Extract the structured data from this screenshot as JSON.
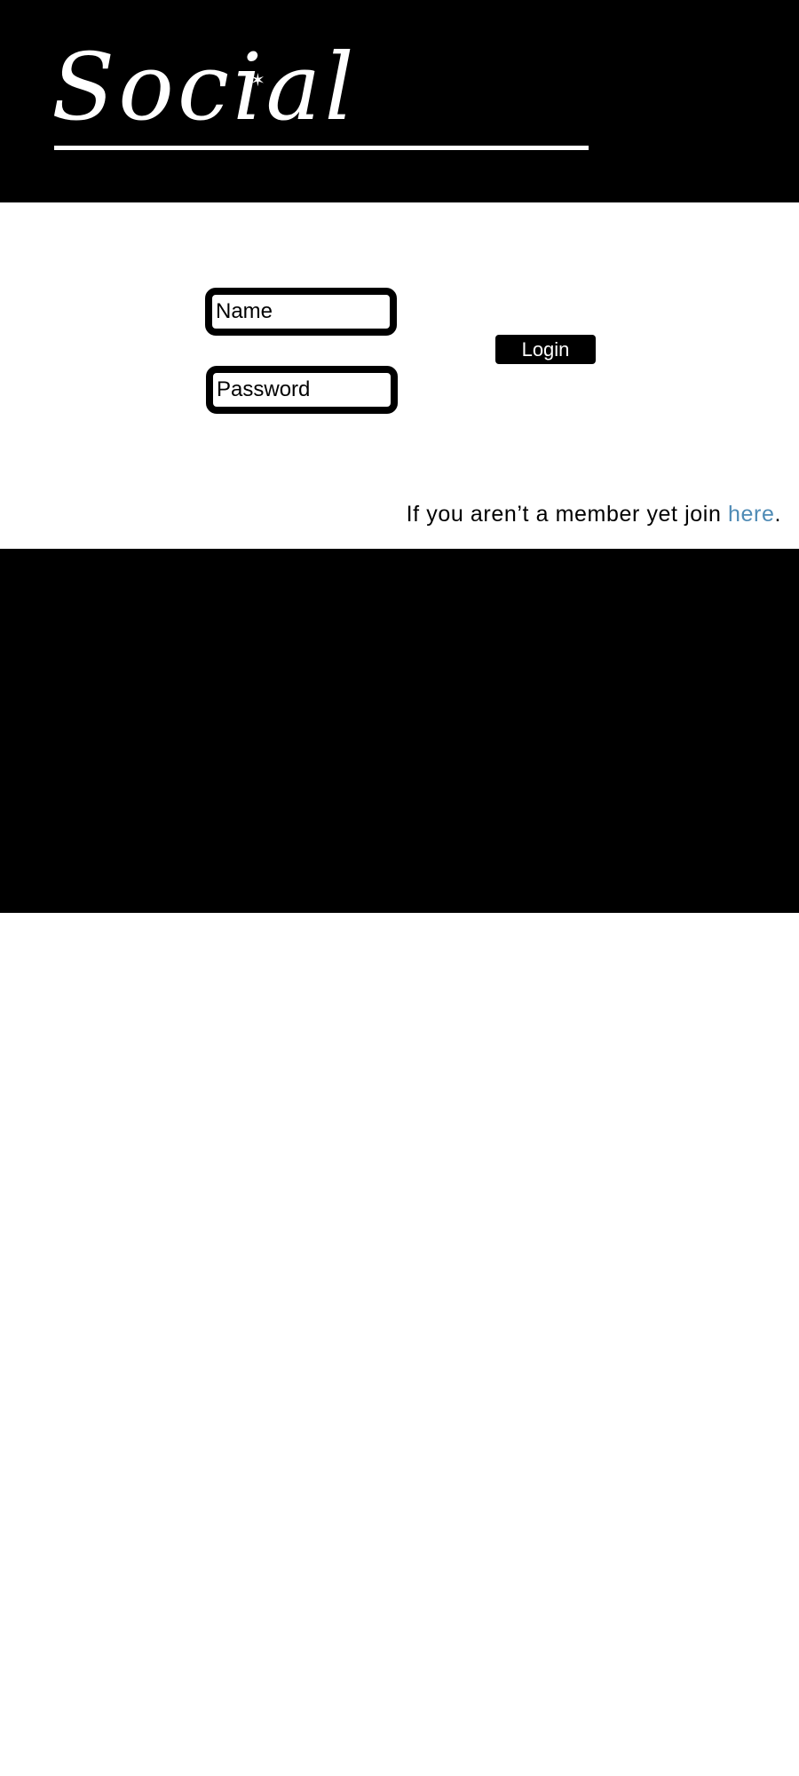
{
  "header": {
    "logo_text": "Social",
    "logo_star": "✶"
  },
  "login": {
    "name_placeholder": "Name",
    "password_placeholder": "Password",
    "button_label": "Login"
  },
  "join": {
    "prefix": "If you aren’t a member yet join ",
    "link_text": "here",
    "suffix": "."
  },
  "colors": {
    "background": "#ffffff",
    "bands": "#000000",
    "link": "#4f8bb5"
  }
}
